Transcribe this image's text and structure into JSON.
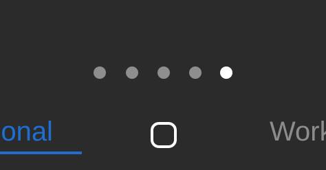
{
  "pager": {
    "dots": [
      {
        "name": "page-dot-1",
        "active": false
      },
      {
        "name": "page-dot-2",
        "active": false
      },
      {
        "name": "page-dot-3",
        "active": false
      },
      {
        "name": "page-dot-4",
        "active": false
      },
      {
        "name": "page-dot-5",
        "active": true
      }
    ]
  },
  "tabs": {
    "personal_label": "rsonal",
    "work_label": "Work"
  },
  "icons": {
    "apps_switch": "rounded-square-icon"
  },
  "colors": {
    "background": "#2b2b2b",
    "accent": "#1f6fd2",
    "inactive_tab": "#8c8c8c",
    "inactive_dot": "#8e8e8e",
    "active_dot": "#ffffff"
  }
}
